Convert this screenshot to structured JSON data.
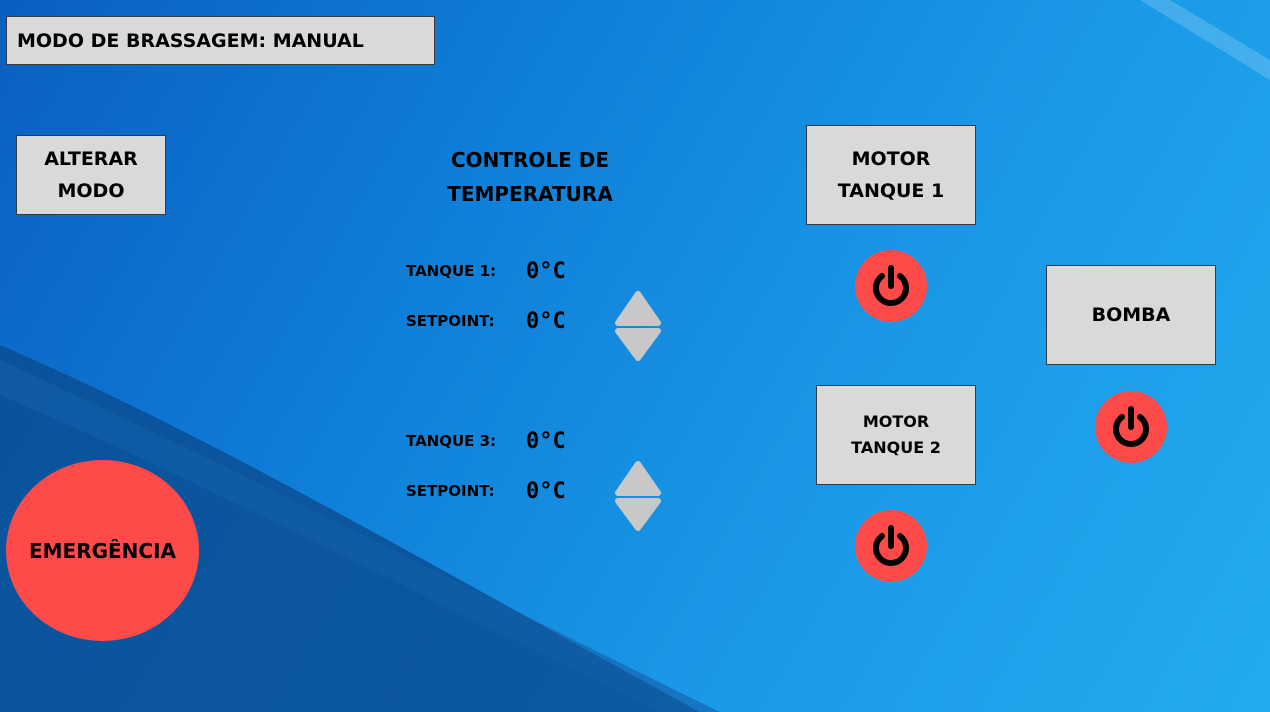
{
  "header": {
    "mode_label": "MODO DE BRASSAGEM: MANUAL"
  },
  "alterar_modo": {
    "line1": "ALTERAR",
    "line2": "MODO"
  },
  "controle": {
    "line1": "CONTROLE DE",
    "line2": "TEMPERATURA"
  },
  "tanque1": {
    "label": "TANQUE 1:",
    "value": "0°C",
    "setpoint_label": "SETPOINT:",
    "setpoint_value": "0°C"
  },
  "tanque3": {
    "label": "TANQUE 3:",
    "value": "0°C",
    "setpoint_label": "SETPOINT:",
    "setpoint_value": "0°C"
  },
  "motor1": {
    "line1": "MOTOR",
    "line2": "TANQUE 1"
  },
  "motor2": {
    "line1": "MOTOR",
    "line2": "TANQUE 2"
  },
  "bomba": {
    "label": "BOMBA"
  },
  "emergencia": {
    "label": "EMERGÊNCIA"
  },
  "icons": {
    "power": "power-icon",
    "arrow_up": "arrow-up-icon",
    "arrow_down": "arrow-down-icon"
  },
  "colors": {
    "background_dark": "#0a5fc0",
    "background_light": "#22abef",
    "panel": "#d9d9d9",
    "alert_red": "#ff4a4a",
    "arrow_gray": "#c8c8c8"
  }
}
